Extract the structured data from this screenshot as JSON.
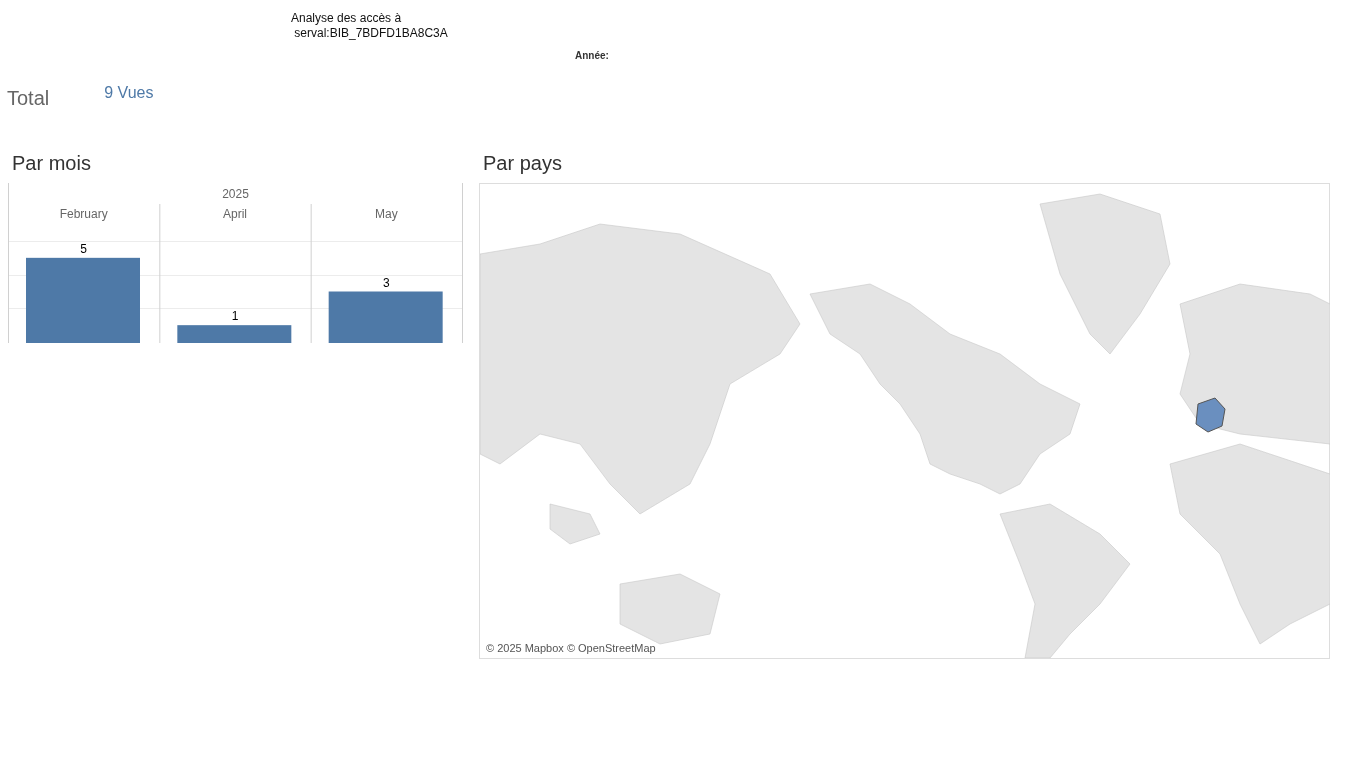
{
  "header": {
    "title": "Analyse des accès à\n serval:BIB_7BDFD1BA8C3A",
    "filter_label": "Année:"
  },
  "total": {
    "label": "Total",
    "value": "9 Vues"
  },
  "by_month": {
    "title": "Par mois",
    "chart_data": {
      "type": "bar",
      "title": "2025",
      "categories": [
        "February",
        "April",
        "May"
      ],
      "values": [
        5,
        1,
        3
      ],
      "data_labels": true
    }
  },
  "by_country": {
    "title": "Par pays",
    "attribution": "© 2025 Mapbox © OpenStreetMap"
  }
}
